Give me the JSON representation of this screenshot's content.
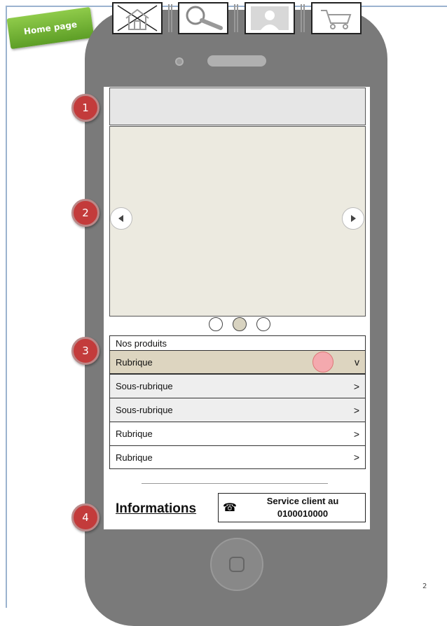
{
  "tag_label": "Home page",
  "toolbar": {
    "icons": [
      "home-icon",
      "search-icon",
      "profile-icon",
      "cart-icon"
    ]
  },
  "badges": [
    "1",
    "2",
    "3",
    "4"
  ],
  "carousel": {
    "dots": 3,
    "active_dot": 2
  },
  "menu": {
    "header": "Nos produits",
    "items": [
      {
        "label": "Rubrique",
        "chevron": "v",
        "highlight": "#ddd5c0"
      },
      {
        "label": "Sous-rubrique",
        "chevron": ">",
        "highlight": "#eeeeee"
      },
      {
        "label": "Sous-rubrique",
        "chevron": ">",
        "highlight": "#eeeeee"
      },
      {
        "label": "Rubrique",
        "chevron": ">",
        "highlight": "#ffffff"
      },
      {
        "label": "Rubrique",
        "chevron": ">",
        "highlight": "#ffffff"
      }
    ]
  },
  "footer": {
    "info_label": "Informations",
    "service_line1": "Service client au",
    "service_line2": "0100010000",
    "phone_glyph": "☎"
  },
  "page_number": "2"
}
